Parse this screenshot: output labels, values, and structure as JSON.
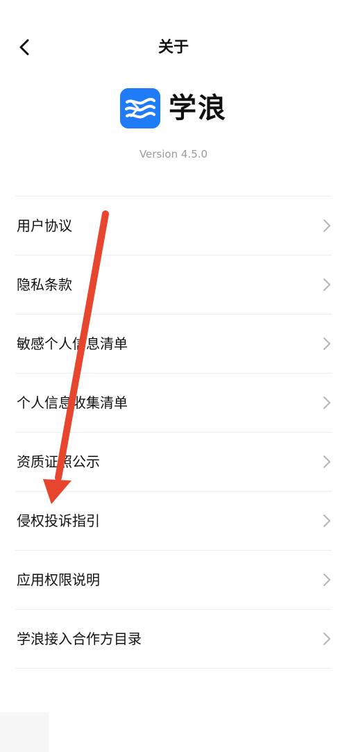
{
  "header": {
    "title": "关于",
    "back_icon": "chevron-left-icon"
  },
  "brand": {
    "app_name": "学浪",
    "logo_icon": "wave-logo-icon",
    "logo_color": "#1f7bf6"
  },
  "version": "Version 4.5.0",
  "menu": {
    "items": [
      {
        "label": "用户协议"
      },
      {
        "label": "隐私条款"
      },
      {
        "label": "敏感个人信息清单"
      },
      {
        "label": "个人信息收集清单"
      },
      {
        "label": "资质证照公示"
      },
      {
        "label": "侵权投诉指引"
      },
      {
        "label": "应用权限说明"
      },
      {
        "label": "学浪接入合作方目录"
      }
    ],
    "chevron_icon": "chevron-right-icon"
  },
  "annotation": {
    "type": "arrow",
    "color": "#e8452f",
    "points_to": "侵权投诉指引"
  }
}
